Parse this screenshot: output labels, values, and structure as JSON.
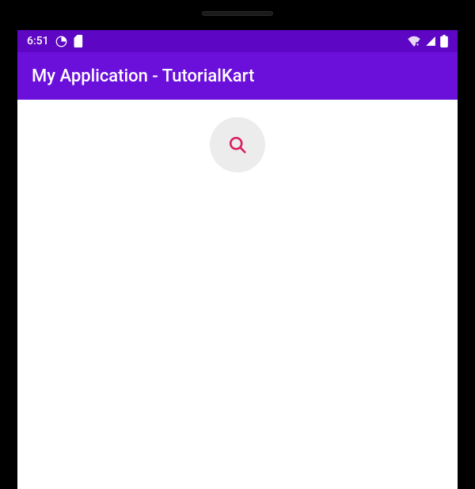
{
  "statusBar": {
    "time": "6:51",
    "colors": {
      "statusBg": "#5d06c3",
      "appBarBg": "#6b10db",
      "accent": "#d81b60"
    }
  },
  "appBar": {
    "title": "My Application - TutorialKart"
  },
  "fab": {
    "iconName": "search"
  }
}
